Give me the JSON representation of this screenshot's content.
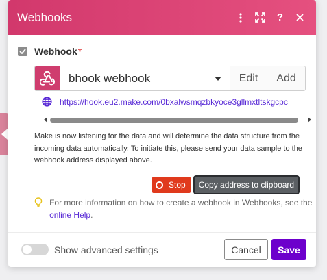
{
  "header": {
    "title": "Webhooks",
    "icons": [
      "more-vertical-icon",
      "expand-icon",
      "help-icon",
      "close-icon"
    ],
    "help_glyph": "?",
    "gradient": [
      "#d2386c",
      "#e5507f"
    ]
  },
  "field": {
    "label": "Webhook",
    "required_mark": "*"
  },
  "webhook": {
    "selected": "bhook webhook",
    "edit_label": "Edit",
    "add_label": "Add",
    "url": "https://hook.eu2.make.com/0bxalwsmqzbkyoce3gllmxtltskgcpc"
  },
  "info": {
    "text": "Make is now listening for the data and will determine the data structure from the incoming data automatically. To initiate this, please send your data sample to the webhook address displayed above."
  },
  "actions": {
    "stop_label": "Stop",
    "copy_label": "Copy address to clipboard"
  },
  "tip": {
    "text_before": "For more information on how to create a webhook in Webhooks, see the ",
    "link_label": "online Help",
    "text_after": "."
  },
  "footer": {
    "advanced_label": "Show advanced settings",
    "advanced_enabled": false,
    "cancel_label": "Cancel",
    "save_label": "Save"
  },
  "colors": {
    "accent": "#6d00cc",
    "stop": "#e03a1d",
    "link": "#5a2bd6"
  }
}
